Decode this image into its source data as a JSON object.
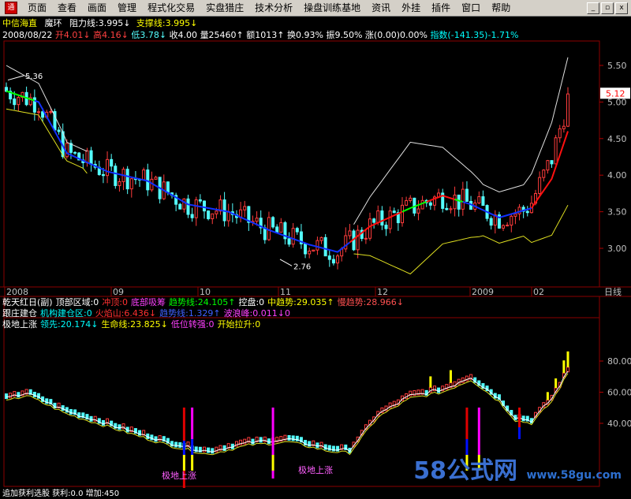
{
  "menubar": {
    "icon_label": "通",
    "items": [
      "页面",
      "查看",
      "画面",
      "管理",
      "程式化交易",
      "实盘猎庄",
      "技术分析",
      "操盘训练基地",
      "资讯",
      "外挂",
      "插件",
      "窗口",
      "帮助"
    ],
    "min": "_",
    "restore": "▫",
    "close": "x"
  },
  "header": {
    "stock_name": "中信海直",
    "formula": "魔环",
    "resistance_label": "阻力线:3.995↓",
    "support_label": "支撑线:3.995↓",
    "date": "2008/08/22",
    "open": "开4.01↓",
    "high": "高4.16↓",
    "low": "低3.78↓",
    "close": "收4.00",
    "volume": "量25460↑",
    "amount": "额1013↑",
    "turnover": "换0.93%",
    "amplitude": "振9.50%",
    "change": "涨(0.00)0.00%",
    "index": "指数(-141.35)-1.71%"
  },
  "indicators": {
    "row1": [
      "乾天红日(副)",
      "顶部区域:0",
      "冲顶:0",
      "底部吸筹",
      "趋势线:24.105↑",
      "控盘:0",
      "中趋势:29.035↑",
      "慢趋势:28.966↓"
    ],
    "row2": [
      "跟庄建仓",
      "机构建仓区:0",
      "火焰山:6.436↓",
      "趋势线:1.329↑",
      "波浪峰:0.011↓0"
    ],
    "row3": [
      "极地上涨",
      "领先:20.174↓",
      "生命线:23.825↓",
      "低位转强:0",
      "开始拉升:0"
    ],
    "row1_colors": [
      "#ffffff",
      "#ffffff",
      "#ff3030",
      "#ff40ff",
      "#00ff00",
      "#ffffff",
      "#ffff00",
      "#ff5050"
    ],
    "row2_colors": [
      "#ffffff",
      "#00ffff",
      "#ff3030",
      "#4060ff",
      "#ff40ff"
    ],
    "row3_colors": [
      "#ffffff",
      "#00ffff",
      "#ffff00",
      "#ff40ff",
      "#ffff00"
    ]
  },
  "price_axis": {
    "ticks": [
      "5.50",
      "5.00",
      "4.50",
      "4.00",
      "3.50",
      "3.00"
    ],
    "current": "5.12",
    "high_label": "5.36",
    "low_label": "2.76"
  },
  "osc_axis": {
    "ticks": [
      "80.00",
      "60.00",
      "40.00"
    ]
  },
  "time_axis": {
    "labels": [
      "2008",
      "09",
      "10",
      "11",
      "12",
      "2009",
      "02"
    ],
    "period": "日线"
  },
  "annotations": {
    "label1": "极地上涨",
    "label2": "极地上涨"
  },
  "bottom_info": "追加获利选股  获利:0.0  增加:450",
  "watermark": {
    "num": "58",
    "text": "公式网",
    "url": "www.58gu.com"
  },
  "colors": {
    "up": "#ff3c3c",
    "down": "#54ffff",
    "ma_blue": "#1030ff",
    "ma_red": "#ff1010",
    "ma_green": "#00ff00",
    "band_white": "#e0e0e0",
    "band_yellow": "#e0e020"
  }
}
